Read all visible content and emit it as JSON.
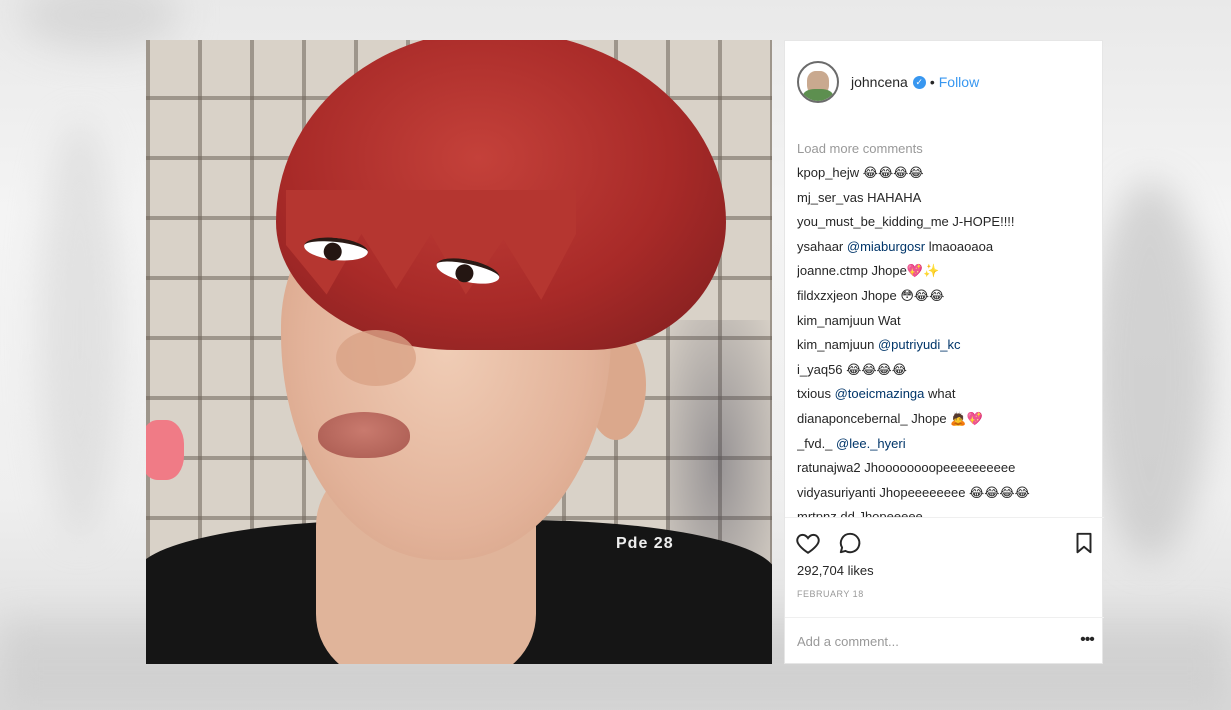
{
  "post": {
    "username": "johncena",
    "follow_label": "Follow",
    "separator": "•",
    "photo_tag": "Pde 28"
  },
  "comments": {
    "load_more": "Load more comments",
    "items": [
      {
        "user": "kpop_hejw",
        "text": "😂😂😂😂"
      },
      {
        "user": "mj_ser_vas",
        "text": "HAHAHA"
      },
      {
        "user": "you_must_be_kidding_me",
        "text": "J-HOPE!!!!"
      },
      {
        "user": "ysahaar",
        "mention": "@miaburgosr",
        "text": "lmaoaoaoa"
      },
      {
        "user": "joanne.ctmp",
        "text": "Jhope💖✨"
      },
      {
        "user": "fildxzxjeon",
        "text": "Jhope 😳😂😂"
      },
      {
        "user": "kim_namjuun",
        "text": "Wat"
      },
      {
        "user": "kim_namjuun",
        "mention": "@putriyudi_kc",
        "text": ""
      },
      {
        "user": "i_yaq56",
        "text": "😂😂😂😂"
      },
      {
        "user": "txious",
        "mention": "@toeicmazinga",
        "text": "what"
      },
      {
        "user": "dianaponcebernal_",
        "text": "Jhope 🙇💖"
      },
      {
        "user": "_fvd._",
        "mention": "@lee._hyeri",
        "text": ""
      },
      {
        "user": "ratunajwa2",
        "text": "Jhoooooooopeeeeeeeeee"
      },
      {
        "user": "vidyasuriyanti",
        "text": "Jhopeeeeeeee 😂😂😂😂"
      },
      {
        "user": "mrtpnz.dd",
        "text": "Jhopeeeee"
      }
    ]
  },
  "stats": {
    "likes": "292,704 likes",
    "date": "FEBRUARY 18"
  },
  "add_comment": {
    "placeholder": "Add a comment...",
    "more_label": "•••"
  },
  "icons": {
    "like": "heart-icon",
    "comment": "comment-bubble-icon",
    "save": "bookmark-icon",
    "verified": "verified-badge-icon",
    "more": "more-options-icon"
  },
  "colors": {
    "accent": "#3897f0",
    "text": "#262626",
    "muted": "#999999",
    "mention": "#003569"
  }
}
